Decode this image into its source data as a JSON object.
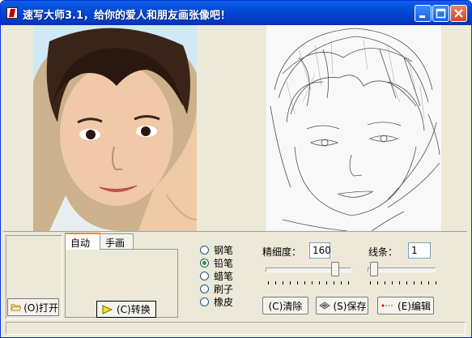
{
  "window": {
    "title": "速写大师3.1，给你的爱人和朋友画张像吧！"
  },
  "left_panel": {
    "open_label": "(O)打开"
  },
  "tabs": [
    {
      "label": "自动"
    },
    {
      "label": "手画"
    }
  ],
  "auto_tab": {
    "convert_label": "(C)转换"
  },
  "tools": {
    "items": [
      {
        "label": "钢笔",
        "selected": false
      },
      {
        "label": "铅笔",
        "selected": true
      },
      {
        "label": "蜡笔",
        "selected": false
      },
      {
        "label": "刷子",
        "selected": false
      },
      {
        "label": "橡皮",
        "selected": false
      }
    ]
  },
  "settings": {
    "precision_label": "精细度：",
    "precision_value": "160",
    "precision_slider_level": 0.86,
    "line_label": "线条：",
    "line_value": "1",
    "line_slider_level": 0.0
  },
  "actions": {
    "clear_label": "(C)清除",
    "save_label": "(S)保存",
    "edit_label": "(E)编辑"
  },
  "status": {
    "text": ""
  }
}
